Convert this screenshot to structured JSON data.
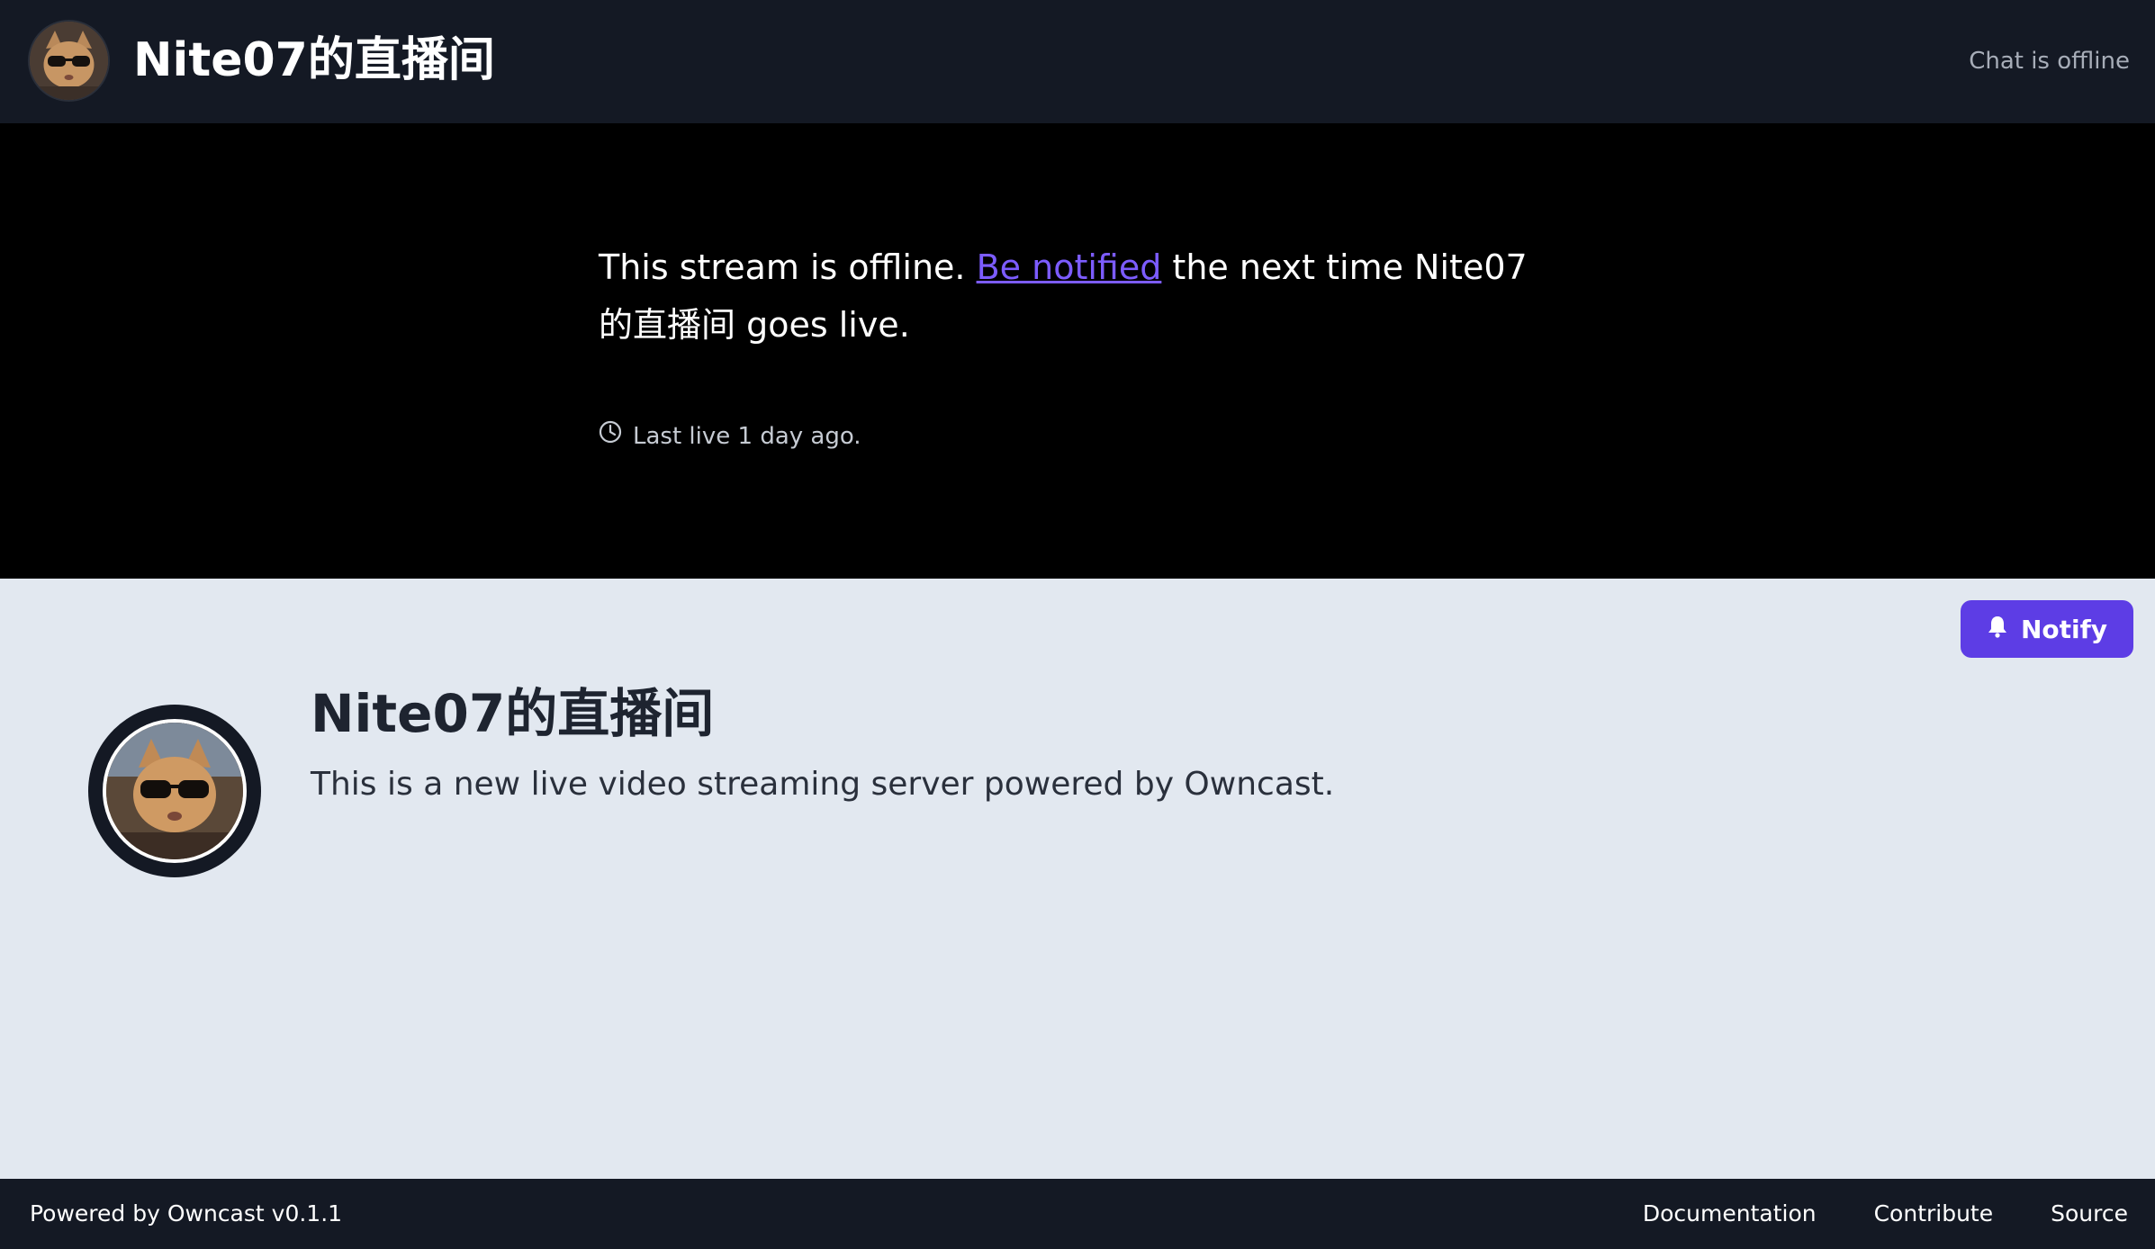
{
  "header": {
    "title": "Nite07的直播间",
    "chat_status": "Chat is offline",
    "avatar_icon": "cat-sunglasses-avatar"
  },
  "player": {
    "offline_prefix": "This stream is offline. ",
    "offline_link": "Be notified",
    "offline_suffix": " the next time Nite07的直播间 goes live.",
    "last_live": "Last live 1 day ago.",
    "clock_icon": "clock-icon"
  },
  "profile": {
    "name": "Nite07的直播间",
    "summary": "This is a new live video streaming server powered by Owncast.",
    "notify_label": "Notify",
    "notify_icon": "bell-icon"
  },
  "footer": {
    "powered_by": "Powered by Owncast v0.1.1",
    "links": [
      "Documentation",
      "Contribute",
      "Source"
    ]
  },
  "colors": {
    "header_bg": "#141924",
    "accent": "#5d3de5",
    "link": "#7c5cff",
    "content_bg": "#e2e8f0"
  }
}
